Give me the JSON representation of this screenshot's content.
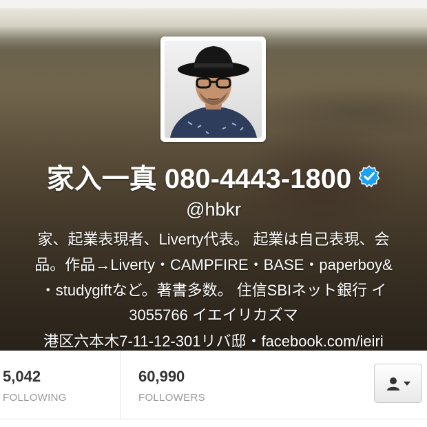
{
  "profile": {
    "name": "家入一真 080-4443-1800",
    "handle": "@hbkr",
    "verified": true,
    "bio_lines": [
      "家、起業表現者、Liverty代表。 起業は自己表現、会",
      "品。作品→Liverty・CAMPFIRE・BASE・paperboy&",
      "・studygiftなど。著書多数。 住信SBIネット銀行 イ",
      "3055766 イエイリカズマ",
      "港区六本木7-11-12-301リバ邸・facebook.com/ieiri"
    ]
  },
  "stats": {
    "following": {
      "value": "5,042",
      "label": "FOLLOWING"
    },
    "followers": {
      "value": "60,990",
      "label": "FOLLOWERS"
    }
  },
  "icons": {
    "verified": "verified-badge-icon",
    "user_actions": "person-icon",
    "dropdown": "caret-down-icon"
  },
  "colors": {
    "verified_blue": "#1da1f2",
    "stat_value": "#333333",
    "stat_label": "#999999"
  }
}
